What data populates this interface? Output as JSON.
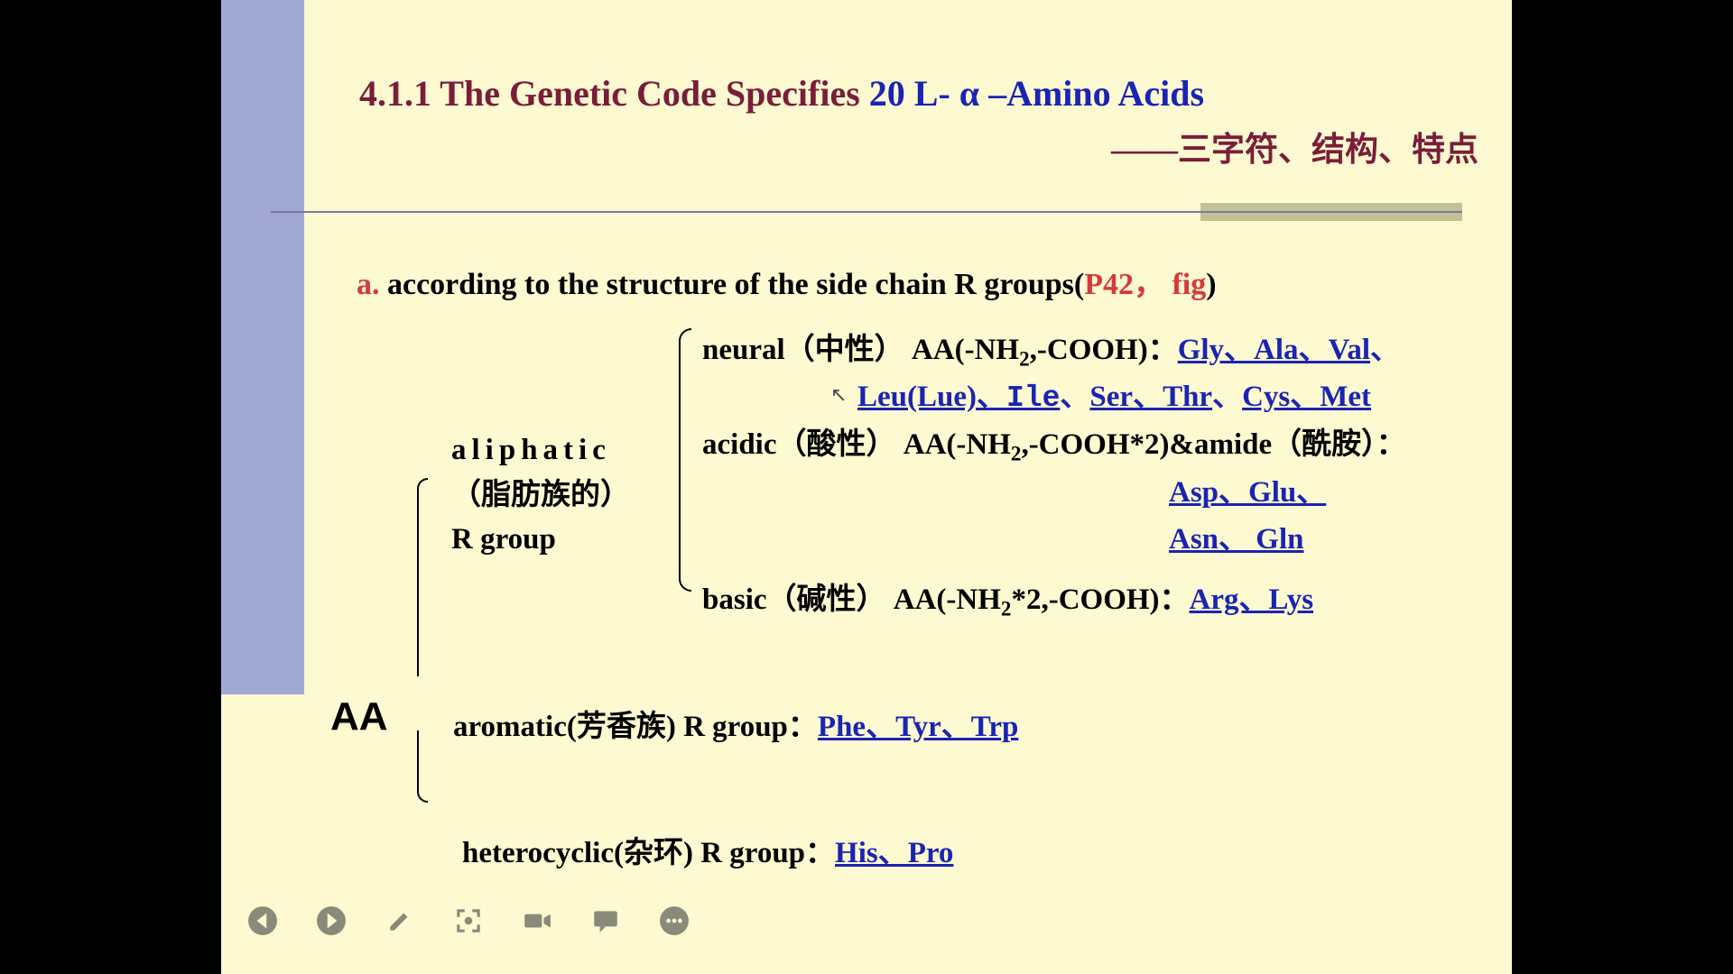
{
  "title": {
    "prefix": "4.1.1 The Genetic Code Specifies ",
    "highlight": "20 L- α –Amino Acids",
    "subtitle": "——三字符、结构、特点"
  },
  "section_a": {
    "label": "a.",
    "text": " according to the structure of the side chain R groups(",
    "ref": "P42， fig",
    "close": ")"
  },
  "root_label": "AA",
  "aliphatic": {
    "word": "aliphatic",
    "paren": "（脂肪族的）",
    "group": "R group"
  },
  "rows": {
    "neural_label": "neural",
    "neural_paren": "（中性）",
    "neural_formula_a": " AA(-NH",
    "neural_formula_b": ",-COOH)：",
    "neural_acids1": "Gly、Ala、Val",
    "neural_sep1": "、",
    "neural_acids2a": "Leu(Lue)、",
    "neural_acids2_ile": "Ile",
    "neural_sep2": "、",
    "neural_acids2b": "Ser、Thr",
    "neural_sep3": "、",
    "neural_acids2c": "Cys、Met",
    "acidic_label": "acidic",
    "acidic_paren": "（酸性）",
    "acidic_formula_a": " AA(-NH",
    "acidic_formula_b": ",-COOH*2)&amide",
    "acidic_paren2": "（酰胺）",
    "acidic_colon": "：",
    "acidic_acids1": "Asp、Glu、",
    "acidic_acids2a": "Asn、",
    "acidic_acids2b": " Gln",
    "basic_label": "basic",
    "basic_paren": "（碱性）",
    "basic_formula_a": " AA(-NH",
    "basic_formula_b": "*2,-COOH)：",
    "basic_acids": "Arg、Lys",
    "aromatic_label": "aromatic(芳香族) R group：",
    "aromatic_acids": "Phe、Tyr、Trp",
    "hetero_label": "heterocyclic(杂环) R group：",
    "hetero_acids": "His、Pro"
  },
  "sub2": "2",
  "toolbar": {
    "prev": "previous-slide",
    "next": "next-slide",
    "pen": "pen-tool",
    "focus": "focus-mode",
    "video": "record-video",
    "chat": "comments",
    "more": "more-options"
  }
}
